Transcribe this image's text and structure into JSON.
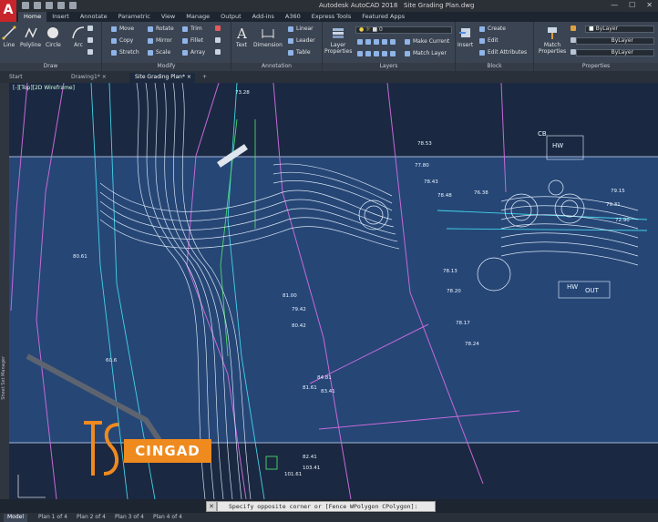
{
  "window": {
    "app_title": "Autodesk AutoCAD 2018",
    "file_title": "Site Grading Plan.dwg",
    "logo_letter": "A"
  },
  "ribbon_tabs": [
    "Home",
    "Insert",
    "Annotate",
    "Parametric",
    "View",
    "Manage",
    "Output",
    "Add-ins",
    "A360",
    "Express Tools",
    "Featured Apps"
  ],
  "draw_panel": {
    "label": "Draw",
    "tools": [
      "Line",
      "Polyline",
      "Circle",
      "Arc"
    ]
  },
  "modify_panel": {
    "label": "Modify",
    "tools": [
      "Move",
      "Rotate",
      "Trim",
      "Copy",
      "Mirror",
      "Fillet",
      "Stretch",
      "Scale",
      "Array"
    ]
  },
  "annotation_panel": {
    "label": "Annotation",
    "tools": [
      "Text",
      "Dimension",
      "Linear",
      "Leader",
      "Table"
    ]
  },
  "layers_panel": {
    "label": "Layers",
    "layer_properties": "Layer Properties",
    "current_layer": "0",
    "make_current": "Make Current",
    "match_layer": "Match Layer"
  },
  "block_panel": {
    "label": "Block",
    "insert": "Insert",
    "create": "Create",
    "edit": "Edit",
    "edit_attributes": "Edit Attributes"
  },
  "properties_panel": {
    "label": "Properties",
    "match_properties": "Match Properties",
    "color": "ByLayer",
    "linetype": "ByLayer",
    "lineweight": "ByLayer"
  },
  "file_tabs": [
    "Start",
    "Drawing1*",
    "Site Grading Plan*"
  ],
  "canvas": {
    "view_label": "[-][Top][2D Wireframe]",
    "palette_label": "Sheet Set Manager",
    "elevations": [
      "73.28",
      "78.43",
      "78.53",
      "79.15",
      "79.31",
      "72.90",
      "78.13",
      "78.17",
      "78.24",
      "78.20",
      "80.61",
      "81.61",
      "82.41",
      "83.41",
      "84.81",
      "101.61",
      "103.41",
      "77.80",
      "76.38",
      "78.48",
      "60.6",
      "79.42",
      "81.00",
      "80.42"
    ],
    "annotations": [
      "HW",
      "OUT",
      "HW",
      "CB"
    ]
  },
  "command_line": {
    "prompt": "Specify opposite corner or [Fence WPolygon CPolygon]:",
    "close": "✕"
  },
  "layout_tabs": [
    "Model",
    "Plan 1 of 4",
    "Plan 2 of 4",
    "Plan 3 of 4",
    "Plan 4 of 4"
  ],
  "logo": {
    "text": "CINGAD",
    "mark": "TS"
  },
  "colors": {
    "canvas_bg": "#1b2841",
    "ribbon_bg": "#3b4452",
    "selection_band": "#2f5ea3",
    "contour": "#e8f4ff",
    "magenta": "#c56ad8",
    "cyan": "#42d4e8",
    "green": "#4cd86a",
    "logo_orange": "#ef8a1f"
  }
}
